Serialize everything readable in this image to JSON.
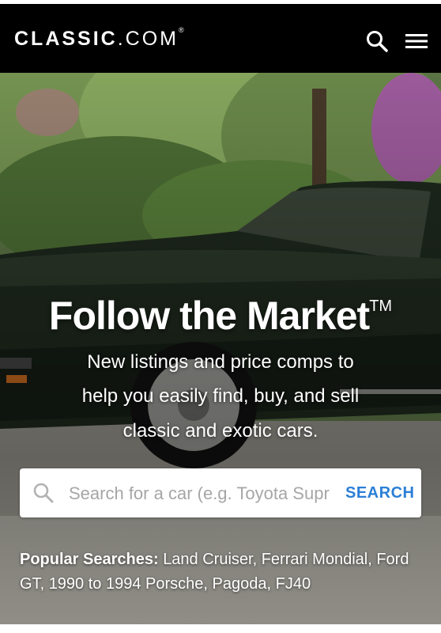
{
  "header": {
    "brand_bold": "CLASSIC",
    "brand_light": ".COM",
    "brand_tm": "®",
    "icons": [
      "search-icon",
      "menu-icon"
    ]
  },
  "hero": {
    "headline": "Follow the Market",
    "headline_tm": "TM",
    "subline_1": "New listings and price comps to",
    "subline_2": "help you easily find, buy, and sell",
    "subline_3": "classic and exotic cars."
  },
  "search": {
    "placeholder": "Search for a car (e.g. Toyota Supra)",
    "button_label": "SEARCH",
    "button_color": "#2b7fd6"
  },
  "popular": {
    "label": "Popular Searches:",
    "items": [
      "Land Cruiser",
      "Ferrari Mondial",
      "Ford GT",
      "1990 to 1994 Porsche",
      "Pagoda",
      "FJ40"
    ]
  }
}
